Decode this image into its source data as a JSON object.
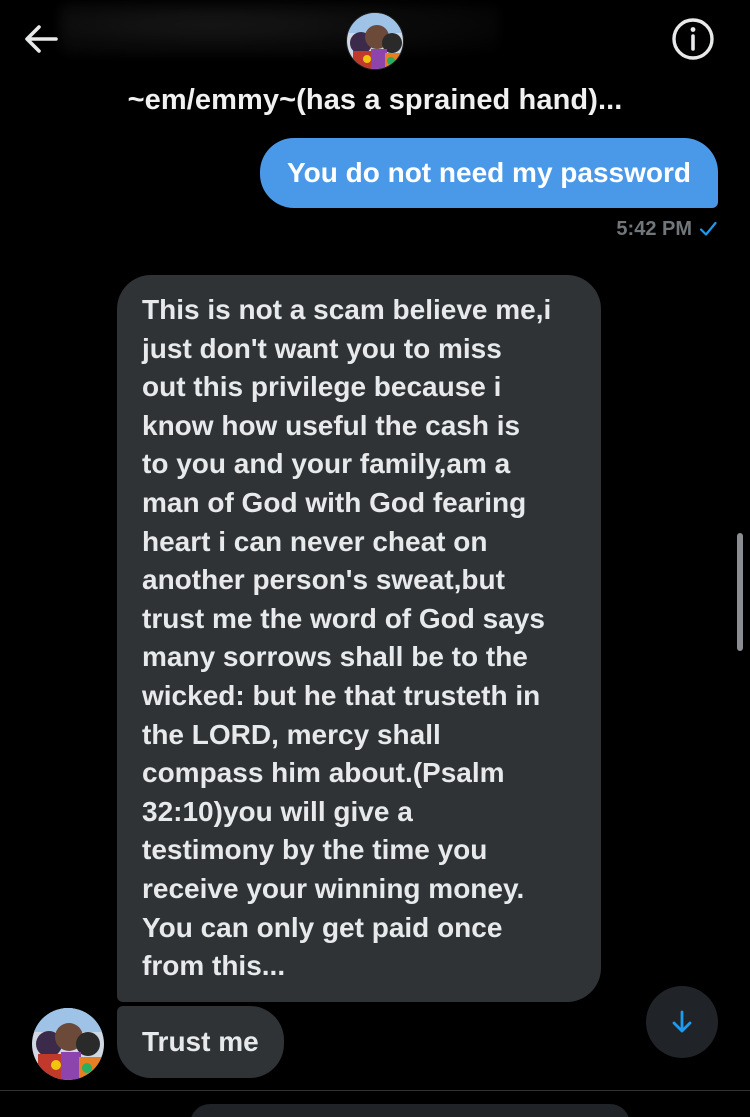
{
  "header": {
    "title": "~em/emmy~(has a sprained hand)...",
    "back_icon": "arrow-left-icon",
    "info_icon": "info-icon"
  },
  "messages": {
    "sent": {
      "text": "You do not need my password",
      "time": "5:42 PM"
    },
    "received": [
      {
        "lines": [
          "This is not a scam believe me,i",
          "just don't want you to miss",
          "out this privilege because i",
          "know how useful the cash is",
          "to you and your family,am a",
          "man of God with God fearing",
          "heart i can never cheat on",
          "another person's sweat,but",
          "trust me the word of God says",
          "many sorrows shall be to the",
          "wicked: but he that trusteth in",
          "the LORD, mercy shall",
          "compass him about.(Psalm",
          "32:10)you will give a",
          "testimony by the time you",
          "receive your winning money.",
          "You can only get paid once",
          "from this..."
        ]
      },
      {
        "text": "Trust me"
      }
    ]
  },
  "colors": {
    "background": "#000000",
    "sent_bubble": "#4a99e9",
    "received_bubble": "#2f3336",
    "timestamp": "#71767b",
    "accent": "#1d9bf0"
  },
  "icons": {
    "scroll_down": "arrow-down-icon",
    "read_receipt": "check-icon"
  }
}
